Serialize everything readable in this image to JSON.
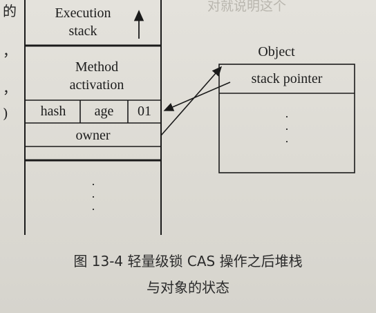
{
  "margin_chars": [
    "的",
    "，",
    "，",
    ")"
  ],
  "bleed_text": "对就说明这个",
  "stack": {
    "title_line1": "Execution",
    "title_line2": "stack",
    "method_line1": "Method",
    "method_line2": "activation",
    "cells": [
      "hash",
      "age",
      "01"
    ],
    "owner": "owner",
    "dots": "·\n·\n·"
  },
  "object": {
    "title": "Object",
    "stack_pointer": "stack pointer",
    "dots": "·\n·\n·"
  },
  "caption": {
    "line1": "图 13-4   轻量级锁 CAS 操作之后堆栈",
    "line2": "与对象的状态"
  }
}
